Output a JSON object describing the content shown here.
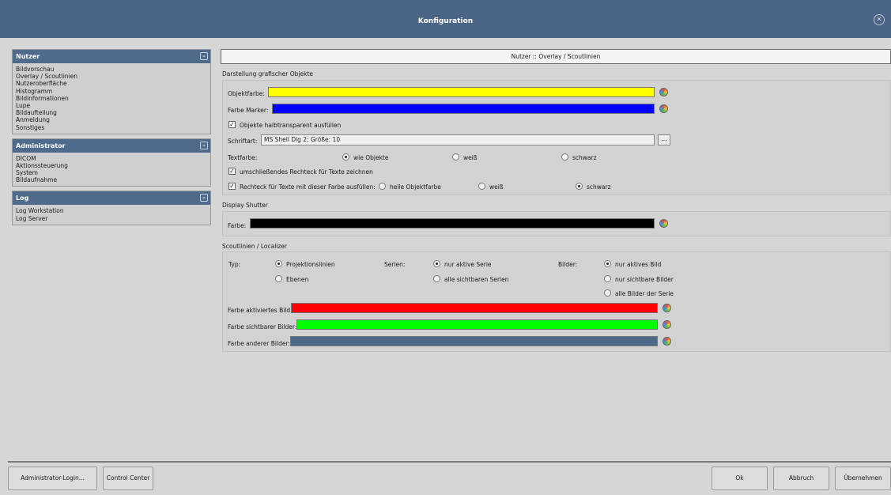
{
  "window": {
    "title": "Konfiguration"
  },
  "sidebar": {
    "sections": [
      {
        "title": "Nutzer",
        "items": [
          "Bildvorschau",
          "Overlay / Scoutlinien",
          "Nutzeroberfläche",
          "Histogramm",
          "Bildinformationen",
          "Lupe",
          "Bildaufteilung",
          "Anmeldung",
          "Sonstiges"
        ]
      },
      {
        "title": "Administrator",
        "items": [
          "DICOM",
          "Aktionssteuerung",
          "System",
          "Bildaufnahme"
        ]
      },
      {
        "title": "Log",
        "items": [
          "Log Workstation",
          "Log Server"
        ]
      }
    ]
  },
  "breadcrumb": "Nutzer :: Overlay / Scoutlinien",
  "graphics": {
    "title": "Darstellung grafischer Objekte",
    "object_color_label": "Objektfarbe:",
    "object_color": "#ffff00",
    "marker_color_label": "Farbe Marker:",
    "marker_color": "#0000ff",
    "fill_semitransparent": "Objekte halbtransparent ausfüllen",
    "font_label": "Schriftart:",
    "font_value": "MS Shell Dlg 2; Größe: 10",
    "font_button": "...",
    "textcolor_label": "Textfarbe:",
    "textcolor_options": [
      "wie Objekte",
      "weiß",
      "schwarz"
    ],
    "textcolor_selected": 0,
    "enclosing_rect": "umschließendes Rechteck für Texte zeichnen",
    "fill_rect": "Rechteck für Texte mit dieser Farbe ausfüllen:",
    "fill_options": [
      "helle Objektfarbe",
      "weiß",
      "schwarz"
    ],
    "fill_selected": 2
  },
  "shutter": {
    "title": "Display Shutter",
    "color_label": "Farbe:",
    "color": "#000000"
  },
  "scout": {
    "title": "Scoutlinien / Localizer",
    "type_label": "Typ:",
    "type_options": [
      "Projektionslinien",
      "Ebenen"
    ],
    "type_selected": 0,
    "series_label": "Serien:",
    "series_options": [
      "nur aktive Serie",
      "alle sichtbaren Serien"
    ],
    "series_selected": 0,
    "images_label": "Bilder:",
    "images_options": [
      "nur aktives Bild",
      "nur sichtbare Bilder",
      "alle Bilder der Serie"
    ],
    "images_selected": 0,
    "active_label": "Farbe aktiviertes Bild:",
    "active_color": "#ff0000",
    "visible_label": "Farbe sichtbarer Bilder:",
    "visible_color": "#00ff00",
    "other_label": "Farbe anderer Bilder:",
    "other_color": "#4d6a8a"
  },
  "footer": {
    "admin_login": "Administrator-Login...",
    "control_center": "Control Center",
    "ok": "Ok",
    "cancel": "Abbruch",
    "apply": "Übernehmen"
  }
}
